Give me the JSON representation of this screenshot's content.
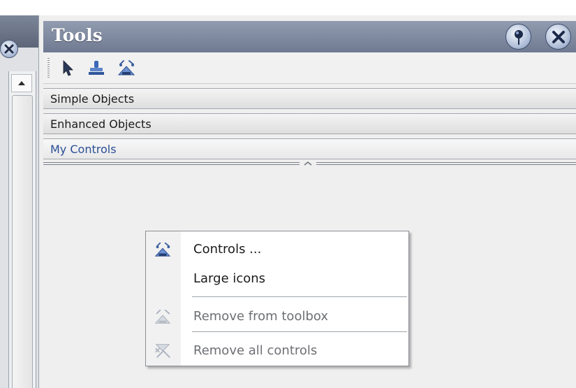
{
  "panel": {
    "title": "Tools"
  },
  "toolbar": {
    "icons": [
      "pointer-icon",
      "stamp-icon",
      "controls-icon"
    ]
  },
  "categories": [
    {
      "label": "Simple Objects"
    },
    {
      "label": "Enhanced Objects"
    },
    {
      "label": "My Controls"
    }
  ],
  "context_menu": {
    "items": [
      {
        "label": "Controls ...",
        "enabled": true,
        "icon": "controls-icon"
      },
      {
        "label": "Large icons",
        "enabled": true,
        "icon": ""
      },
      {
        "label": "Remove from toolbox",
        "enabled": false,
        "icon": "remove-icon"
      },
      {
        "label": "Remove all controls",
        "enabled": false,
        "icon": "remove-all-icon"
      }
    ]
  },
  "colors": {
    "titlebar": "#7c869a",
    "active_category_text": "#2a4e95",
    "disabled_text": "#6d6f73"
  }
}
